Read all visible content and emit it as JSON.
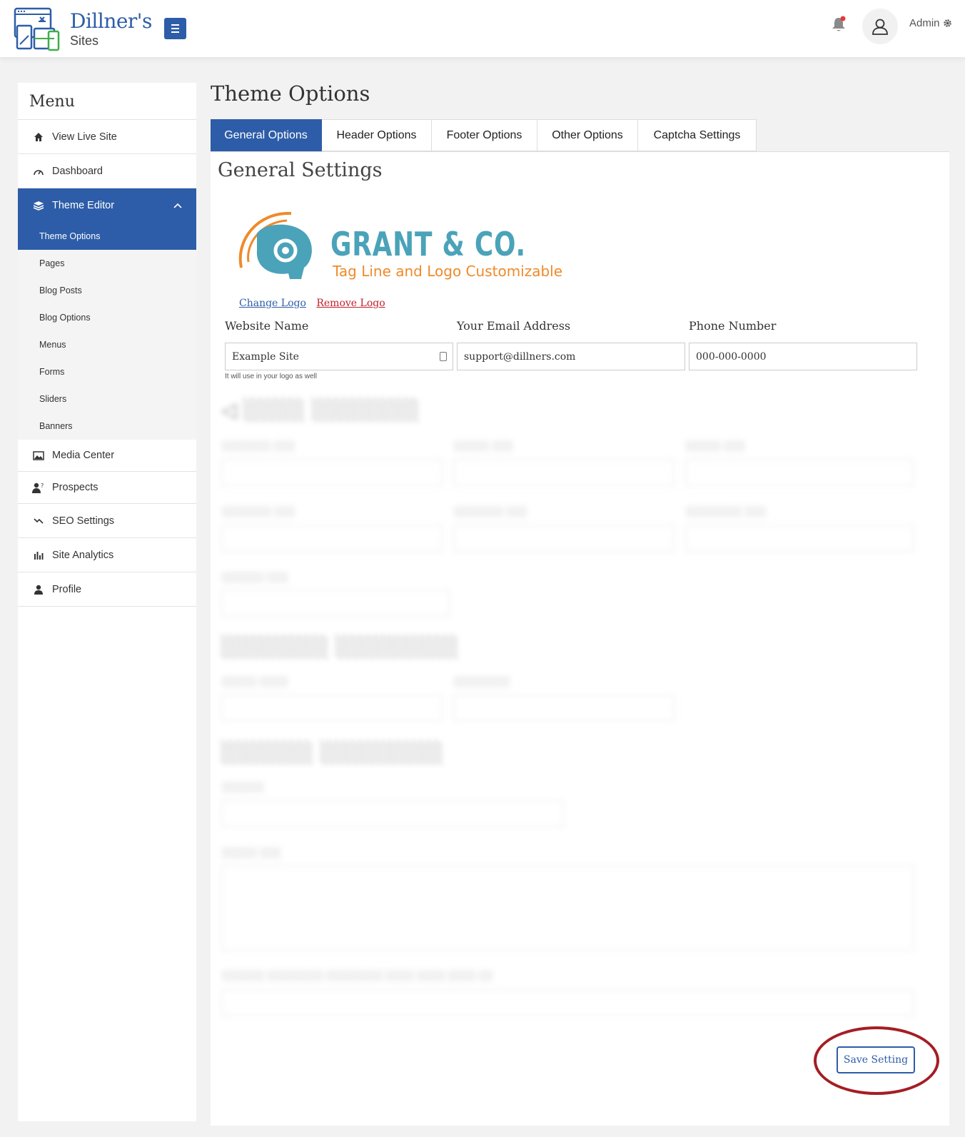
{
  "header": {
    "brand_name": "Dillner's",
    "brand_sub": "Sites",
    "user_label": "Admin"
  },
  "sidebar": {
    "title": "Menu",
    "items": [
      {
        "label": "View Live Site",
        "icon": "home-icon"
      },
      {
        "label": "Dashboard",
        "icon": "gauge-icon"
      },
      {
        "label": "Theme Editor",
        "icon": "layers-icon"
      },
      {
        "label": "Media Center",
        "icon": "image-icon"
      },
      {
        "label": "Prospects",
        "icon": "user-question-icon"
      },
      {
        "label": "SEO Settings",
        "icon": "trend-icon"
      },
      {
        "label": "Site Analytics",
        "icon": "bar-chart-icon"
      },
      {
        "label": "Profile",
        "icon": "user-icon"
      }
    ],
    "theme_sub": [
      "Theme Options",
      "Pages",
      "Blog Posts",
      "Blog Options",
      "Menus",
      "Forms",
      "Sliders",
      "Banners"
    ]
  },
  "main": {
    "page_title": "Theme Options",
    "tabs": [
      "General Options",
      "Header Options",
      "Footer Options",
      "Other Options",
      "Captcha Settings"
    ],
    "section_title": "General Settings",
    "logo": {
      "name": "GRANT & CO.",
      "tagline": "Tag Line and Logo Customizable"
    },
    "change_logo": "Change Logo",
    "remove_logo": "Remove Logo",
    "fields": {
      "website_name": {
        "label": "Website Name",
        "value": "Example Site",
        "help": "It will use in your logo as well"
      },
      "email": {
        "label": "Your Email Address",
        "value": "support@dillners.com"
      },
      "phone": {
        "label": "Phone Number",
        "value": "000-000-0000"
      }
    },
    "save_label": "Save Setting"
  },
  "colors": {
    "accent": "#2d5da8",
    "highlight_ring": "#a51d24",
    "logo_teal": "#4aa3b9",
    "logo_orange": "#ef8a2a"
  }
}
